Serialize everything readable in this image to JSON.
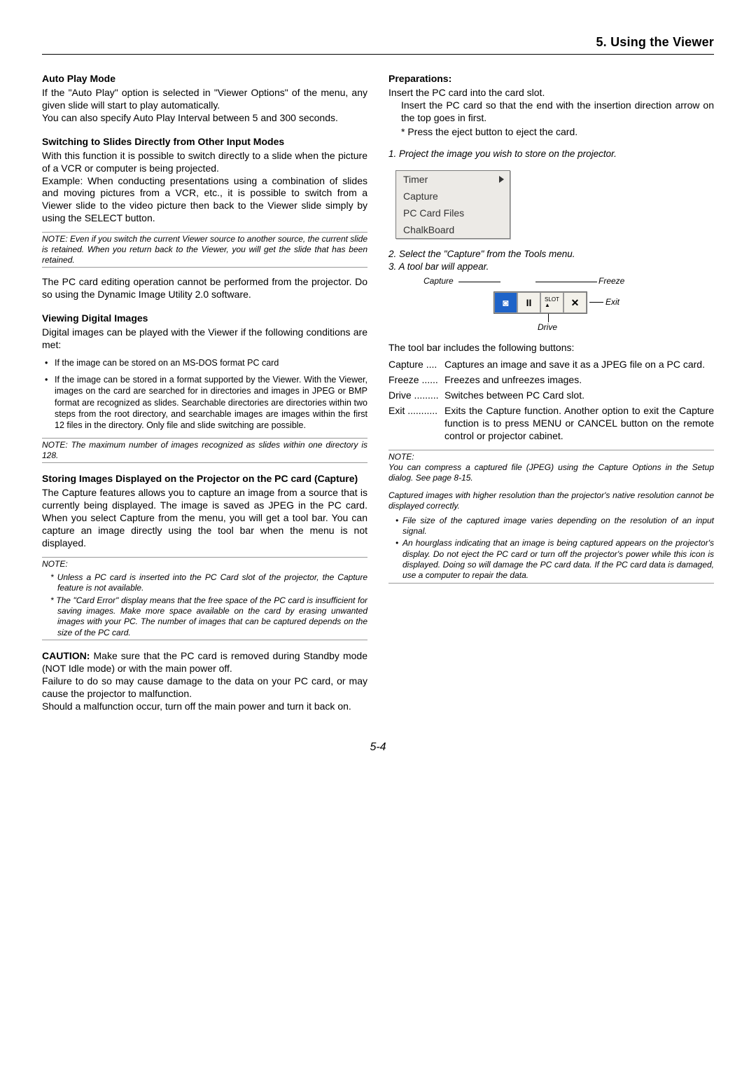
{
  "header": {
    "section": "5. Using the Viewer"
  },
  "left": {
    "auto_play_h": "Auto Play Mode",
    "auto_play_p": "If the \"Auto Play\" option is selected in \"Viewer Options\" of the menu, any given slide will start to play automatically.\nYou can also specify Auto Play Interval between 5 and 300 seconds.",
    "switch_h": "Switching to Slides Directly from Other Input Modes",
    "switch_p": "With this function it is possible to switch directly to a slide when the picture of a VCR or computer is being projected.\nExample: When conducting presentations using a combination of slides and moving pictures from a VCR, etc., it is possible to switch from a Viewer slide to the video picture then back to the Viewer slide simply by using the SELECT button.",
    "switch_note": "NOTE: Even if you switch the current Viewer source to another source, the current slide is retained. When you return back to the Viewer, you will get the slide that has been retained.",
    "switch_after_note": "The PC card editing operation cannot be performed from the projector. Do so using the Dynamic Image Utility 2.0 software.",
    "view_h": "Viewing Digital Images",
    "view_p": "Digital images can be played with the Viewer if the following conditions are met:",
    "view_li1": "If the image can be stored on an MS-DOS format PC card",
    "view_li2": "If the image can be stored in a format supported by the Viewer. With the Viewer, images on the card are searched for in directories and images in JPEG or BMP format are recognized as slides. Searchable directories are directories within two steps from the root directory, and searchable images are images within the first 12 files in the directory. Only file and slide switching are possible.",
    "view_note": "NOTE: The maximum number of images recognized as slides within one directory is 128.",
    "store_h": "Storing Images Displayed on the Projector on the PC card (Capture)",
    "store_p": "The Capture features allows you to capture an image from a source that is currently being displayed. The image is saved as JPEG in the PC card. When you select Capture from the menu, you will get a tool bar. You can capture an image directly using the tool bar when the menu is not displayed.",
    "store_note_hdr": "NOTE:",
    "store_note_1": "* Unless a PC card is inserted into the PC Card slot of the projector, the Capture feature is not available.",
    "store_note_2": "* The \"Card Error\" display means that the free space of the PC card is insufficient for saving images. Make more space available on the card by erasing unwanted images with your PC. The number of images that can be captured depends on the size of the PC card.",
    "caution": "CAUTION:",
    "caution_p": " Make sure that the PC card is removed during Standby mode (NOT Idle mode) or with the main power off.\nFailure to do so may cause damage to the data on your PC card, or may cause the projector to malfunction.\nShould a malfunction occur, turn off the main power and turn it back on."
  },
  "right": {
    "prep_h": "Preparations:",
    "prep_p1": "Insert the PC card into the card slot.",
    "prep_p2": "Insert the PC card so that the end with the insertion direction arrow on the top goes in first.",
    "prep_p3": "* Press the eject button to eject the card.",
    "step1": "1. Project the image you wish to store on the projector.",
    "menu": {
      "timer": "Timer",
      "capture": "Capture",
      "files": "PC Card Files",
      "chalk": "ChalkBoard"
    },
    "step2": "2. Select the \"Capture\" from the Tools menu.",
    "step3": "3. A tool bar will appear.",
    "labels": {
      "capture": "Capture",
      "freeze": "Freeze",
      "exit": "Exit",
      "drive": "Drive"
    },
    "after_tb": "The tool bar includes the following buttons:",
    "defs": {
      "capture_l": "Capture ....",
      "capture_v": "Captures an image and save it as a JPEG file on a PC card.",
      "freeze_l": "Freeze ......",
      "freeze_v": "Freezes and unfreezes images.",
      "drive_l": "Drive .........",
      "drive_v": "Switches between PC Card slot.",
      "exit_l": "Exit ...........",
      "exit_v": "Exits the Capture function. Another option to exit the Capture function is to press MENU or CANCEL button on the remote control or projector cabinet."
    },
    "note_hdr": "NOTE:",
    "note_p1": "You can compress a captured file (JPEG) using the Capture Options in the Setup dialog. See page 8-15.",
    "note_p2": "Captured images with higher resolution than the projector's native resolution cannot be displayed correctly.",
    "note_li1": "File size of the captured image varies depending on the resolution of an input signal.",
    "note_li2": "An hourglass indicating that an image is being captured appears on the projector's display. Do not eject the PC card or turn off the projector's power while this icon is displayed. Doing so will damage the PC card data. If the PC card data is damaged, use a computer to repair the data."
  },
  "page_number": "5-4"
}
